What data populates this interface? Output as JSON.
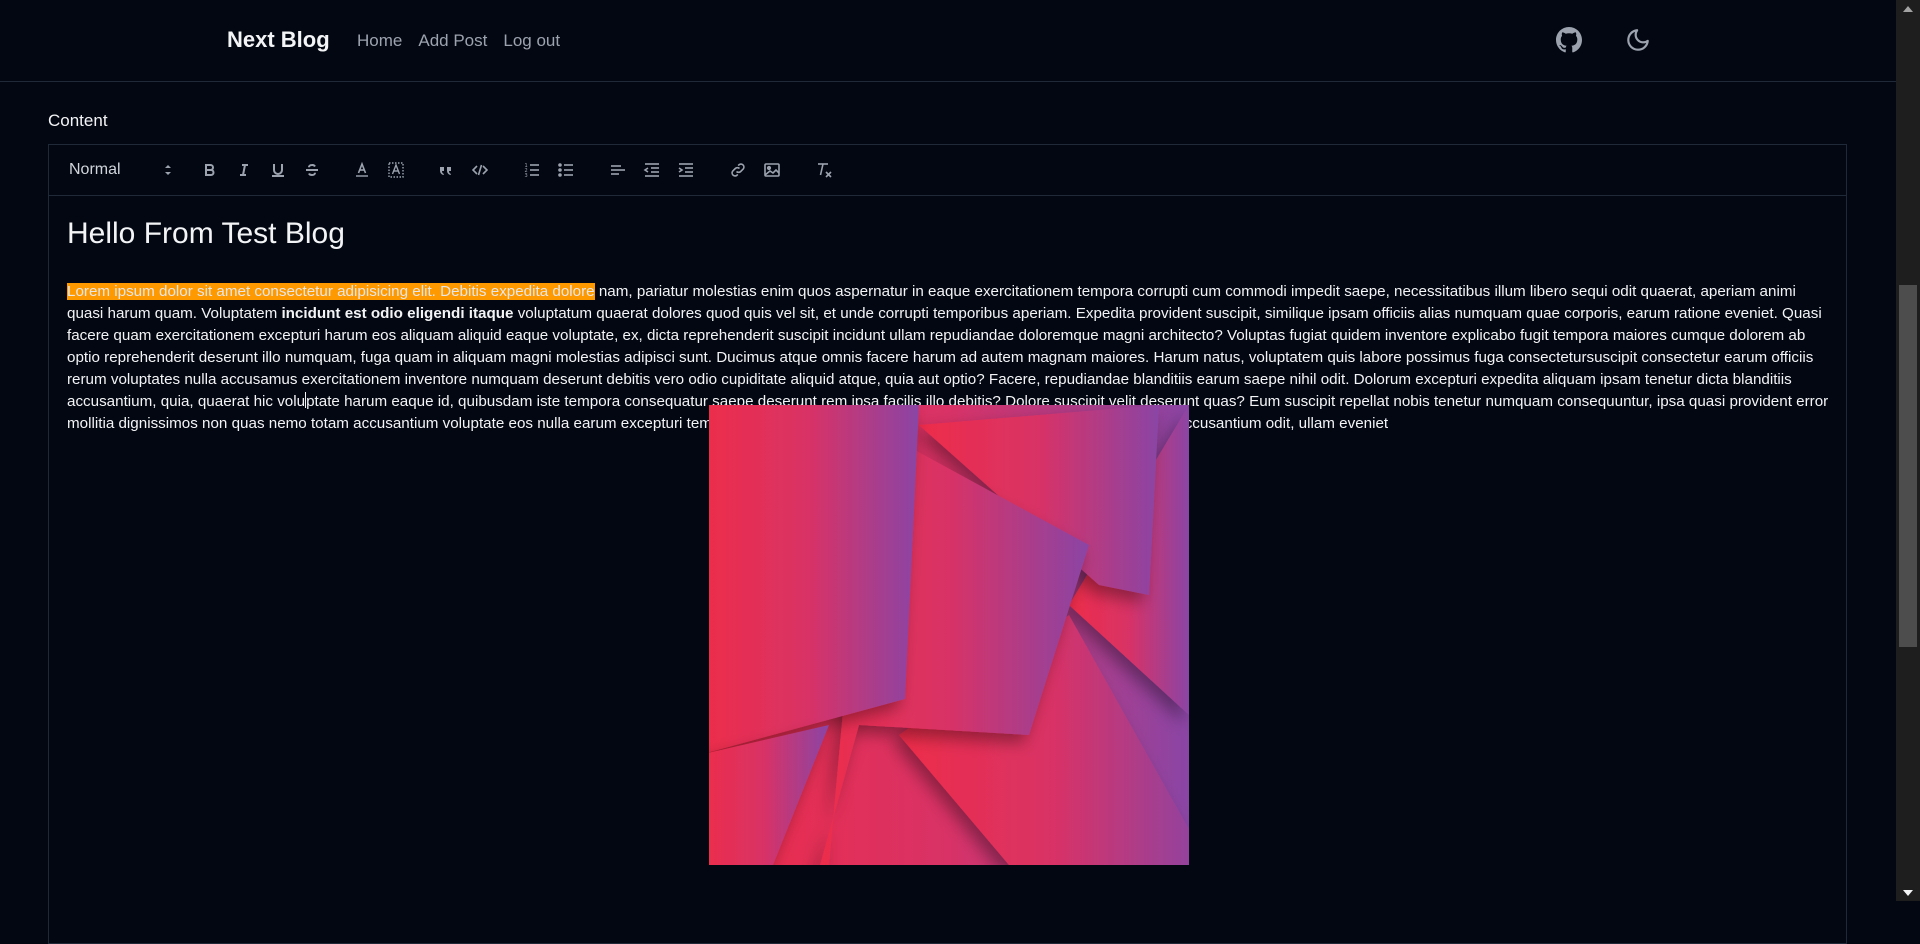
{
  "nav": {
    "brand": "Next Blog",
    "links": [
      "Home",
      "Add Post",
      "Log out"
    ],
    "icons": [
      "github-icon",
      "moon-icon"
    ]
  },
  "editor": {
    "label": "Content",
    "header_select": "Normal",
    "toolbar_buttons": [
      "bold",
      "italic",
      "underline",
      "strike",
      "font-color",
      "background-color",
      "blockquote",
      "code-block",
      "ordered-list",
      "bullet-list",
      "align",
      "indent-decrease",
      "indent-increase",
      "link",
      "image",
      "clean-format"
    ],
    "title": "Hello From Test Blog",
    "para": {
      "highlighted": "Lorem ipsum dolor sit amet consectetur adipisicing elit. Debitis expedita dolore",
      "part1": " nam, pariatur molestias enim quos aspernatur in eaque exercitationem tempora corrupti cum commodi impedit saepe, necessitatibus illum libero sequi odit quaerat, aperiam animi quasi harum quam. Voluptatem ",
      "bold": "incidunt est odio eligendi itaque",
      "part2": " voluptatum quaerat dolores quod quis vel sit, et unde corrupti temporibus aperiam. Expedita provident suscipit, similique ipsam officiis alias numquam quae corporis, earum ratione eveniet. Quasi facere quam exercitationem excepturi harum eos aliquam aliquid eaque voluptate, ex, dicta reprehenderit suscipit incidunt ullam repudiandae doloremque magni architecto? Voluptas fugiat quidem inventore explicabo fugit tempora maiores cumque dolorem ab optio reprehenderit deserunt illo numquam, fuga quam in aliquam magni molestias adipisci sunt. Ducimus atque omnis facere harum ad autem magnam maiores. Harum natus, voluptatem quis labore possimus fuga consectetursuscipit consectetur earum officiis rerum voluptates nulla accusamus exercitationem inventore numquam deserunt debitis vero odio cupiditate aliquid atque, quia aut optio? Facere, repudiandae blanditiis earum saepe nihil odit. Dolorum excepturi expedita aliquam ipsam tenetur dicta blanditiis accusantium, quia, quaerat hic volu",
      "part3": "ptate harum eaque id, quibusdam iste tempora consequatur saepe deserunt rem ipsa facilis illo debitis? Dolore suscipit velit deserunt quas? Eum suscipit repellat nobis tenetur numquam consequuntur, ipsa quasi provident error mollitia dignissimos non quas nemo totam accusantium voluptate eos nulla earum excepturi temporibus harum, iure iusto! Assumenda, illum dolores. Ad voluptatibus accusantium odit, ullam eveniet"
    }
  },
  "colors": {
    "background": "#030712",
    "highlight": "#ff9900",
    "gradient_start": "#ee2c49",
    "gradient_end": "#8a45a5"
  }
}
